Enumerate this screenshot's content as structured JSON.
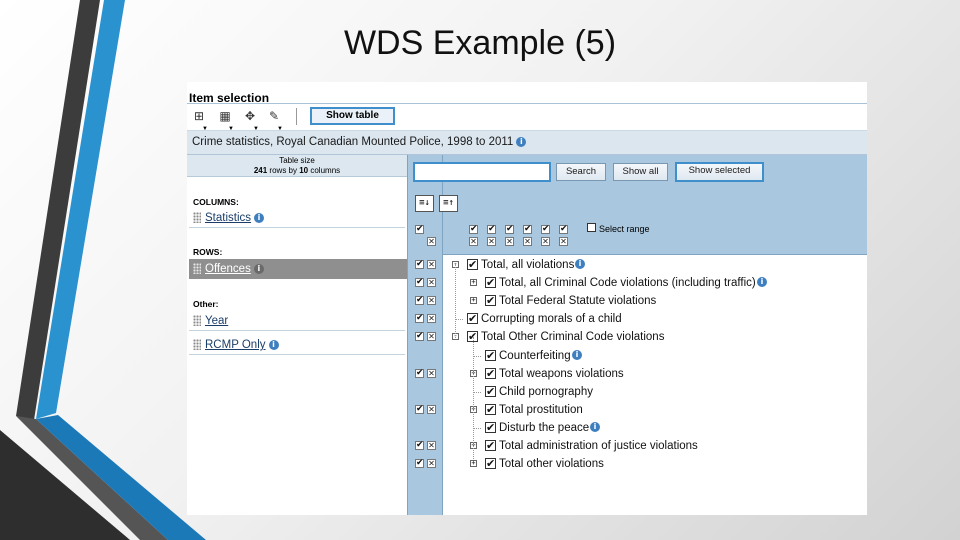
{
  "slide": {
    "title": "WDS Example (5)"
  },
  "window": {
    "title": "Item selection",
    "show_table_label": "Show table",
    "toolbar_icons": [
      "layout-icon",
      "table-view-icon",
      "chart-icon",
      "export-icon"
    ],
    "subject": "Crime statistics, Royal Canadian Mounted Police, 1998 to 2011"
  },
  "left": {
    "table_size_title": "Table size",
    "rows_count": "241",
    "rows_text": "rows by",
    "cols_count": "10",
    "cols_text": "columns",
    "columns_heading": "COLUMNS:",
    "rows_heading": "ROWS:",
    "other_heading": "Other:",
    "columns": [
      {
        "label": "Statistics",
        "info": true
      }
    ],
    "rows": [
      {
        "label": "Offences",
        "info": true,
        "active": true
      }
    ],
    "other": [
      {
        "label": "Year",
        "info": false
      },
      {
        "label": "RCMP Only",
        "info": true
      }
    ]
  },
  "search": {
    "value": "",
    "search_label": "Search",
    "show_all_label": "Show all",
    "show_selected_label": "Show selected",
    "select_range_label": "Select range"
  },
  "tree": [
    {
      "label": "Total, all violations",
      "info": true,
      "level": 0,
      "exp": "-"
    },
    {
      "label": "Total, all Criminal Code violations (including traffic)",
      "info": true,
      "level": 1,
      "exp": "+"
    },
    {
      "label": "Total Federal Statute violations",
      "info": false,
      "level": 1,
      "exp": "+"
    },
    {
      "label": "Corrupting morals of a child",
      "info": false,
      "level": 0,
      "exp": ""
    },
    {
      "label": "Total Other Criminal Code violations",
      "info": false,
      "level": 0,
      "exp": "-"
    },
    {
      "label": "Counterfeiting",
      "info": true,
      "level": 1,
      "exp": ""
    },
    {
      "label": "Total weapons violations",
      "info": false,
      "level": 1,
      "exp": "+"
    },
    {
      "label": "Child pornography",
      "info": false,
      "level": 1,
      "exp": ""
    },
    {
      "label": "Total prostitution",
      "info": false,
      "level": 1,
      "exp": "+"
    },
    {
      "label": "Disturb the peace",
      "info": true,
      "level": 1,
      "exp": ""
    },
    {
      "label": "Total administration of justice violations",
      "info": false,
      "level": 1,
      "exp": "+"
    },
    {
      "label": "Total other violations",
      "info": false,
      "level": 1,
      "exp": "+"
    }
  ]
}
